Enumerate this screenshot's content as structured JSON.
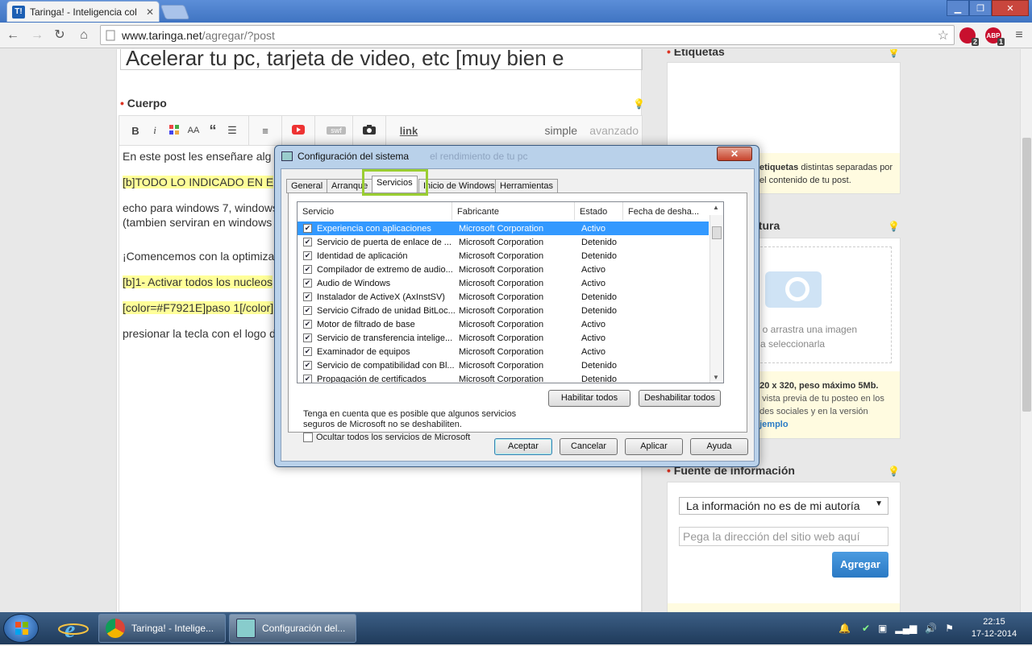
{
  "browser": {
    "tab_title": "Taringa! - Inteligencia col",
    "tab_favicon": "T!",
    "url_host": "www.taringa.net",
    "url_path": "/agregar/?post",
    "ext_badge1": "2",
    "ext_badge2": "1",
    "ext_abp": "ABP"
  },
  "editor": {
    "title_value": "Acelerar tu pc, tarjeta de video, etc [muy bien e",
    "cuerpo_label": "Cuerpo",
    "toolbar": {
      "bold": "B",
      "italic": "i",
      "font": "AA",
      "quote": "“",
      "swf": "swf",
      "link": "link"
    },
    "mode_simple": "simple",
    "mode_advanced": "avanzado",
    "body_lines": [
      "En este post les enseñare alg",
      "[b]TODO LO INDICADO EN E",
      "echo para windows 7, windows",
      "(tambien serviran en windows",
      "¡Comencemos con la optimiza",
      "[b]1- Activar todos los nucleos",
      "[color=#F7921E]paso 1[/color]",
      "presionar la tecla con el logo d"
    ]
  },
  "sidebar": {
    "etiquetas_label": "Etiquetas",
    "etiquetas_help_bold": "etiquetas",
    "etiquetas_help": "distintas separadas por",
    "etiquetas_help2": "el contenido de tu post.",
    "miniatura_label": "atura",
    "miniatura_text1": "í o arrastra una imagen",
    "miniatura_text2": "a seleccionarla",
    "miniatura_size": "320 x 320, peso máximo 5Mb.",
    "miniatura_note1": "e vista previa de tu posteo en los",
    "miniatura_note2": "edes sociales y en la versión",
    "miniatura_link": "ejemplo",
    "fuente_label": "Fuente de información",
    "fuente_select": "La información no es de mi autoría",
    "fuente_placeholder": "Pega la dirección del sitio web aquí",
    "agregar_label": "Agregar"
  },
  "dialog": {
    "title": "Configuración del sistema",
    "tabs": [
      "General",
      "Arranque",
      "Servicios",
      "Inicio de Windows",
      "Herramientas"
    ],
    "columns": [
      "Servicio",
      "Fabricante",
      "Estado",
      "Fecha de desha..."
    ],
    "rows": [
      {
        "name": "Experiencia con aplicaciones",
        "maker": "Microsoft Corporation",
        "state": "Activo"
      },
      {
        "name": "Servicio de puerta de enlace de ...",
        "maker": "Microsoft Corporation",
        "state": "Detenido"
      },
      {
        "name": "Identidad de aplicación",
        "maker": "Microsoft Corporation",
        "state": "Detenido"
      },
      {
        "name": "Compilador de extremo de audio...",
        "maker": "Microsoft Corporation",
        "state": "Activo"
      },
      {
        "name": "Audio de Windows",
        "maker": "Microsoft Corporation",
        "state": "Activo"
      },
      {
        "name": "Instalador de ActiveX (AxInstSV)",
        "maker": "Microsoft Corporation",
        "state": "Detenido"
      },
      {
        "name": "Servicio Cifrado de unidad BitLoc...",
        "maker": "Microsoft Corporation",
        "state": "Detenido"
      },
      {
        "name": "Motor de filtrado de base",
        "maker": "Microsoft Corporation",
        "state": "Activo"
      },
      {
        "name": "Servicio de transferencia intelige...",
        "maker": "Microsoft Corporation",
        "state": "Activo"
      },
      {
        "name": "Examinador de equipos",
        "maker": "Microsoft Corporation",
        "state": "Activo"
      },
      {
        "name": "Servicio de compatibilidad con Bl...",
        "maker": "Microsoft Corporation",
        "state": "Detenido"
      },
      {
        "name": "Propagación de certificados",
        "maker": "Microsoft Corporation",
        "state": "Detenido"
      }
    ],
    "note": "Tenga en cuenta que es posible que algunos servicios seguros de Microsoft no se deshabiliten.",
    "enable_all": "Habilitar todos",
    "disable_all": "Deshabilitar todos",
    "hide_ms": "Ocultar todos los servicios de Microsoft",
    "ok": "Aceptar",
    "cancel": "Cancelar",
    "apply": "Aplicar",
    "help": "Ayuda",
    "behind_text": "el rendimiento de tu pc"
  },
  "taskbar": {
    "task1": "Taringa! - Intelige...",
    "task2": "Configuración del...",
    "time": "22:15",
    "date": "17-12-2014"
  }
}
